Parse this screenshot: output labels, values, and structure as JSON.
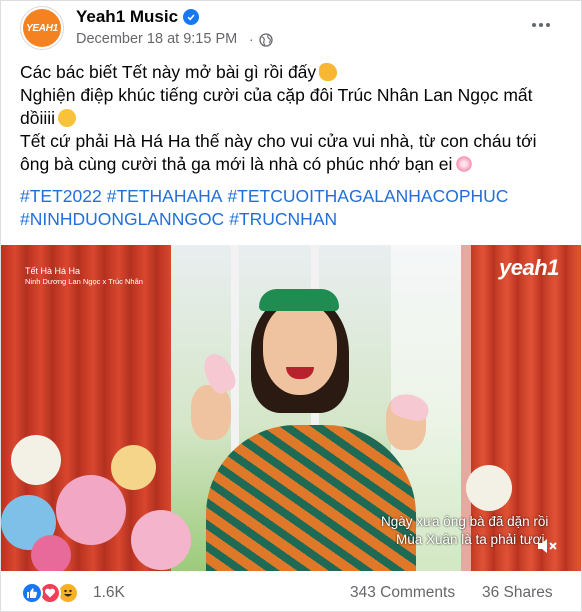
{
  "post": {
    "page_name": "Yeah1 Music",
    "avatar_label": "YEAH1",
    "date": "December 18 at 9:15 PM",
    "separator": "·",
    "text_lines": [
      "Các bác biết Tết này mở bài gì rồi đấy",
      "Nghiện điệp khúc tiếng cười của cặp đôi Trúc Nhân Lan Ngọc mất dồiiii",
      "Tết cứ phải Hà Há Ha thế này cho vui cửa vui nhà, từ con cháu tới ông bà cùng cười thả ga mới là nhà có phúc nhớ bạn ei"
    ],
    "hashtags": [
      "#TET2022",
      "#TETHAHAHA",
      "#TETCUOITHAGALANHACOPHUC",
      "#NINHDUONGLANNGOC",
      "#TRUCNHAN"
    ]
  },
  "video": {
    "title": "Tết Hà Há Ha",
    "artists": "Ninh Dương Lan Ngọc x Trúc Nhân",
    "watermark": "yeah1",
    "subtitle_line1": "Ngày xưa ông bà đã dặn rồi",
    "subtitle_line2": "Mùa Xuân là ta phải tươi"
  },
  "footer": {
    "reaction_count": "1.6K",
    "comments": "343 Comments",
    "shares": "36 Shares",
    "reactions": [
      "like-icon",
      "love-icon",
      "haha-icon"
    ]
  },
  "colors": {
    "accent": "#1877f2",
    "hashtag": "#216fdb",
    "secondary_text": "#65676b",
    "brand_orange": "#f58220"
  }
}
